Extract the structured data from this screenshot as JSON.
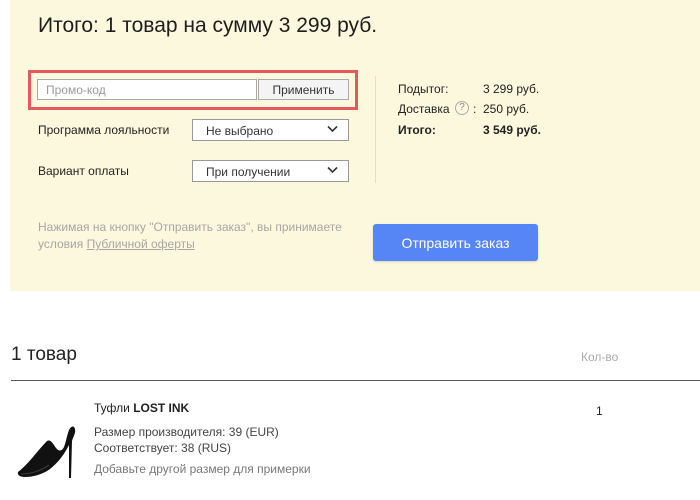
{
  "summary": {
    "title": "Итого: 1 товар на сумму 3 299 руб.",
    "promo": {
      "placeholder": "Промо-код",
      "value": "",
      "apply_label": "Применить",
      "highlight_color": "#e4595b"
    },
    "loyalty": {
      "label": "Программа лояльности",
      "selected": "Не выбрано"
    },
    "payment": {
      "label": "Вариант оплаты",
      "selected": "При получении"
    },
    "totals": {
      "subtotal_label": "Подытог:",
      "subtotal_value": "3 299 руб.",
      "delivery_label": "Доставка",
      "delivery_help": "?",
      "delivery_colon": ":",
      "delivery_value": "250 руб.",
      "total_label": "Итого:",
      "total_value": "3 549 руб."
    },
    "notice_text": "Нажимая на кнопку \"Отправить заказ\", вы принимаете условия",
    "notice_link": "Публичной оферты",
    "submit_label": "Отправить заказ",
    "background_color": "#fcf8dd",
    "accent_color": "#5686f5"
  },
  "items": {
    "title": "1 товар",
    "qty_header": "Кол-во",
    "list": [
      {
        "type": "Туфли",
        "brand": "LOST INK",
        "size_manufacturer": "Размер производителя: 39 (EUR)",
        "size_matches": "Соответствует: 38 (RUS)",
        "add_size": "Добавьте другой размер для примерки",
        "qty": "1",
        "image_icon": "black-pump-shoe"
      }
    ]
  }
}
